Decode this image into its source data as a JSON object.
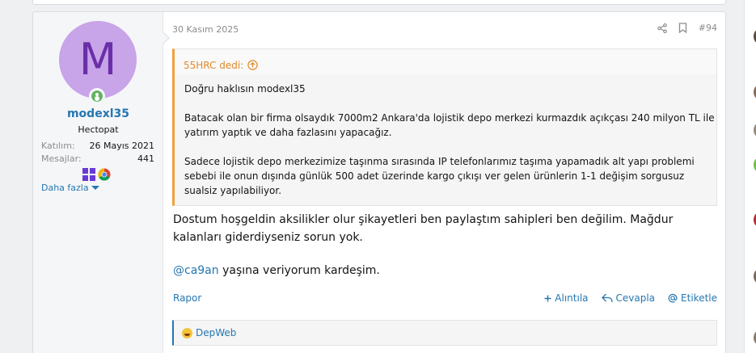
{
  "post": {
    "date": "30 Kasım 2025",
    "number": "#94",
    "user": {
      "avatar_letter": "M",
      "username": "modexl35",
      "title": "Hectopat",
      "stats": [
        {
          "key": "Katılım:",
          "value": "26 Mayıs 2021"
        },
        {
          "key": "Mesajlar:",
          "value": "441"
        }
      ],
      "more_label": "Daha fazla"
    },
    "quote": {
      "author_line": "55HRC dedi:",
      "paragraphs": [
        "Doğru haklısın modexl35",
        "Batacak olan bir firma olsaydık 7000m2 Ankara'da lojistik depo merkezi kurmazdık açıkçası 240 milyon TL ile yatırım yaptık ve daha fazlasını yapacağız.",
        "Sadece lojistik depo merkezimize taşınma sırasında IP telefonlarımız taşıma yapamadık alt yapı problemi sebebi ile onun dışında günlük 500 adet üzerinde kargo çıkışı ver gelen ürünlerin 1-1 değişim sorgusuz sualsiz yapılabiliyor."
      ]
    },
    "message": {
      "line1": "Dostum hoşgeldin aksilikler olur şikayetleri ben paylaştım sahipleri ben değilim. Mağdur kalanları giderdiyseniz sorun yok.",
      "mention": "@ca9an",
      "line2": " yaşına veriyorum kardeşim."
    },
    "footer": {
      "report": "Rapor",
      "quote_action": "Alıntıla",
      "reply_action": "Cevapla",
      "tag_action": "Etiketle"
    },
    "reactions": {
      "user": "DepWeb"
    }
  },
  "colors": {
    "link": "#2577b1",
    "quote_accent": "#f0a03c",
    "avatar_bg": "#c8a4e8",
    "online": "#63b265"
  }
}
